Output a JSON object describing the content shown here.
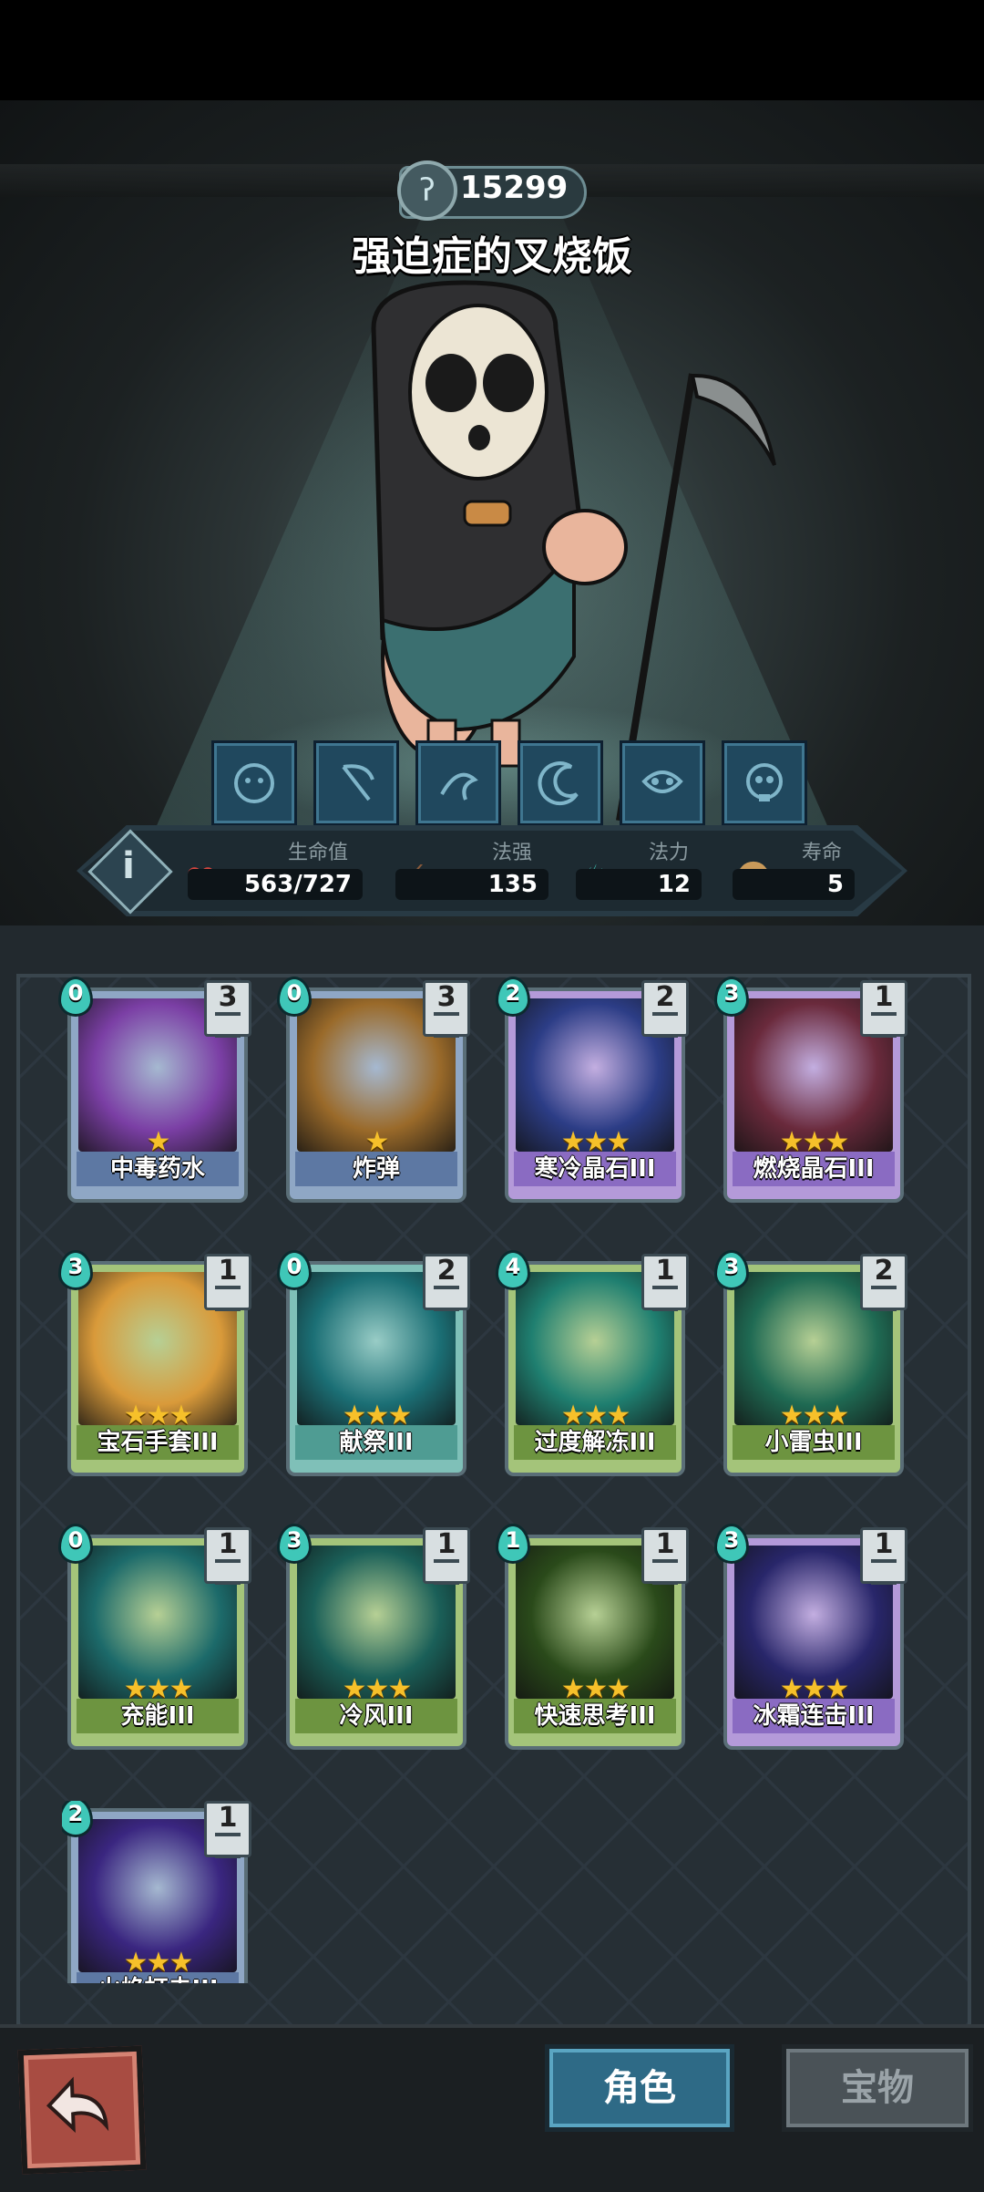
{
  "hero": {
    "score": "15299",
    "name": "强迫症的叉烧饭",
    "skills": [
      "ghost-icon",
      "scythe-icon",
      "swirl-icon",
      "crescent-icon",
      "mask-icon",
      "skull-icon"
    ]
  },
  "stats": {
    "hp_label": "生命值",
    "hp_value": "563/727",
    "power_label": "法强",
    "power_value": "135",
    "mana_label": "法力",
    "mana_value": "12",
    "life_label": "寿命",
    "life_value": "5"
  },
  "cards": [
    {
      "name": "中毒药水",
      "cost": "0",
      "count": "3",
      "stars": "★",
      "art": "poison-potion",
      "frame": "blue",
      "bg": "#7b3fa5"
    },
    {
      "name": "炸弹",
      "cost": "0",
      "count": "3",
      "stars": "★",
      "art": "bomb",
      "frame": "blue",
      "bg": "#9a6a2a"
    },
    {
      "name": "寒冷晶石III",
      "cost": "2",
      "count": "2",
      "stars": "★★★",
      "art": "ice-crystal",
      "frame": "purple",
      "bg": "#2c3d86"
    },
    {
      "name": "燃烧晶石III",
      "cost": "3",
      "count": "1",
      "stars": "★★★",
      "art": "fire-crystal",
      "frame": "purple",
      "bg": "#6a2a3c"
    },
    {
      "name": "宝石手套III",
      "cost": "3",
      "count": "1",
      "stars": "★★★",
      "art": "gem-gauntlet",
      "frame": "green",
      "bg": "#d99a3a"
    },
    {
      "name": "献祭III",
      "cost": "0",
      "count": "2",
      "stars": "★★★",
      "art": "sacrifice",
      "frame": "teal",
      "bg": "#1b6f75"
    },
    {
      "name": "过度解冻III",
      "cost": "4",
      "count": "1",
      "stars": "★★★",
      "art": "ice-cube",
      "frame": "green",
      "bg": "#1f7f70"
    },
    {
      "name": "小雷虫III",
      "cost": "3",
      "count": "2",
      "stars": "★★★",
      "art": "thunder-ghost",
      "frame": "green",
      "bg": "#1f6a53"
    },
    {
      "name": "充能III",
      "cost": "0",
      "count": "1",
      "stars": "★★★",
      "art": "charge",
      "frame": "green",
      "bg": "#1c6a6a"
    },
    {
      "name": "冷风III",
      "cost": "3",
      "count": "1",
      "stars": "★★★",
      "art": "cold-wind",
      "frame": "green",
      "bg": "#1a5f58"
    },
    {
      "name": "快速思考III",
      "cost": "1",
      "count": "1",
      "stars": "★★★",
      "art": "quick-think",
      "frame": "green",
      "bg": "#2a4a1a"
    },
    {
      "name": "冰霜连击III",
      "cost": "3",
      "count": "1",
      "stars": "★★★",
      "art": "frost-combo",
      "frame": "purple",
      "bg": "#28266a"
    },
    {
      "name": "火焰打击III",
      "cost": "2",
      "count": "1",
      "stars": "★★★",
      "art": "fire-strike",
      "frame": "blue",
      "bg": "#3a2680"
    }
  ],
  "tabs": {
    "role": "角色",
    "treasure": "宝物"
  },
  "colors": {
    "mana": "#3fc7b8",
    "star": "#f6c02a",
    "hp": "#d9463f"
  }
}
